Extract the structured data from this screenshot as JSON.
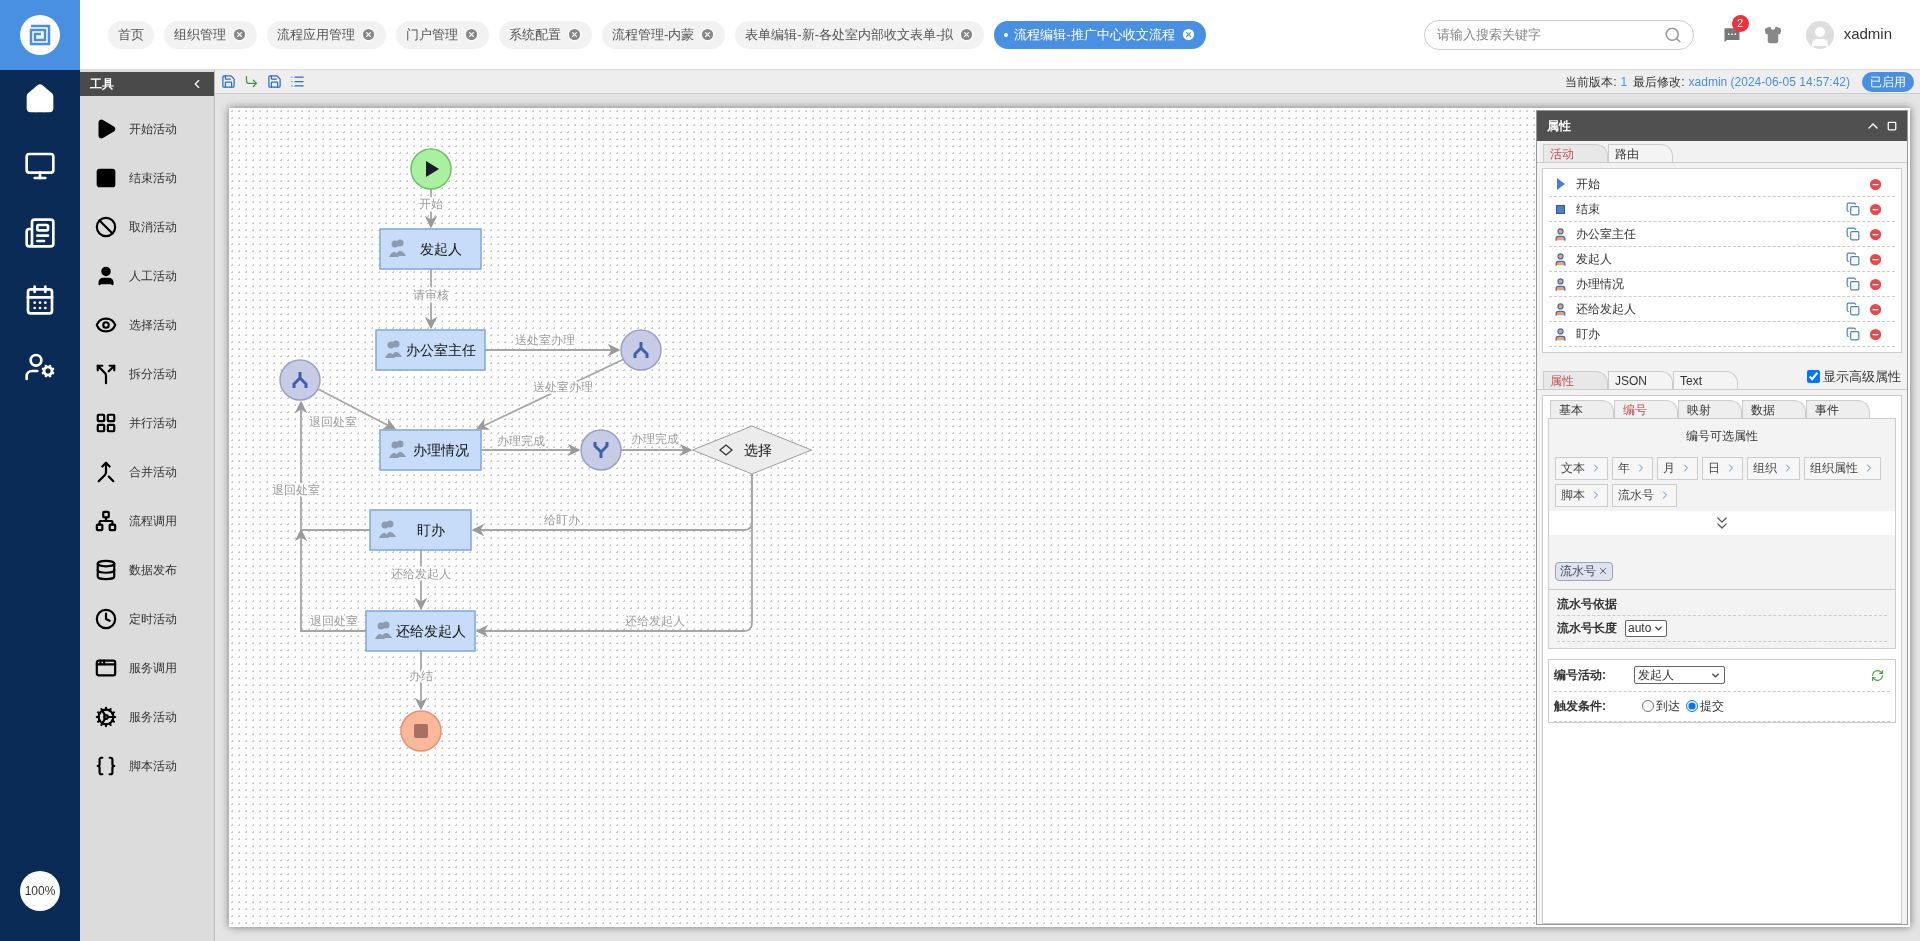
{
  "top_tabs": [
    {
      "label": "首页",
      "closable": false,
      "selected": false
    },
    {
      "label": "组织管理",
      "closable": true,
      "selected": false
    },
    {
      "label": "流程应用管理",
      "closable": true,
      "selected": false
    },
    {
      "label": "门户管理",
      "closable": true,
      "selected": false
    },
    {
      "label": "系统配置",
      "closable": true,
      "selected": false
    },
    {
      "label": "流程管理-内蒙",
      "closable": true,
      "selected": false
    },
    {
      "label": "表单编辑-新-各处室内部收文表单-拟",
      "closable": true,
      "selected": false
    },
    {
      "label": "流程编辑-推广中心收文流程",
      "closable": true,
      "selected": true
    }
  ],
  "search": {
    "placeholder": "请输入搜索关键字"
  },
  "notifications": {
    "badge": "2"
  },
  "user": {
    "name": "xadmin"
  },
  "zoom": "100%",
  "toolbox": {
    "title": "工具",
    "items": [
      {
        "label": "开始活动",
        "kind": "start"
      },
      {
        "label": "结束活动",
        "kind": "end"
      },
      {
        "label": "取消活动",
        "kind": "cancel"
      },
      {
        "label": "人工活动",
        "kind": "manual"
      },
      {
        "label": "选择活动",
        "kind": "choice"
      },
      {
        "label": "拆分活动",
        "kind": "split"
      },
      {
        "label": "并行活动",
        "kind": "parallel"
      },
      {
        "label": "合并活动",
        "kind": "merge"
      },
      {
        "label": "流程调用",
        "kind": "subprocess"
      },
      {
        "label": "数据发布",
        "kind": "publish"
      },
      {
        "label": "定时活动",
        "kind": "timer"
      },
      {
        "label": "服务调用",
        "kind": "invoke"
      },
      {
        "label": "服务活动",
        "kind": "service"
      },
      {
        "label": "脚本活动",
        "kind": "script"
      }
    ]
  },
  "version_bar": {
    "version_label": "当前版本:",
    "version": "1",
    "modified_label": "最后修改:",
    "modified": "xadmin (2024-06-05 14:57:42)",
    "status": "已启用"
  },
  "diagram": {
    "nodes": [
      {
        "kind": "start"
      },
      {
        "kind": "task",
        "label": "发起人"
      },
      {
        "kind": "task",
        "label": "办公室主任"
      },
      {
        "kind": "split"
      },
      {
        "kind": "split"
      },
      {
        "kind": "task",
        "label": "办理情况"
      },
      {
        "kind": "merge"
      },
      {
        "kind": "choice",
        "label": "选择"
      },
      {
        "kind": "task",
        "label": "盯办"
      },
      {
        "kind": "task",
        "label": "还给发起人"
      },
      {
        "kind": "end"
      }
    ],
    "edges": [
      {
        "label": "开始"
      },
      {
        "label": "请审核"
      },
      {
        "label": "送处室办理"
      },
      {
        "label": "送处室办理"
      },
      {
        "label": "退回处室"
      },
      {
        "label": "办理完成"
      },
      {
        "label": "办理完成"
      },
      {
        "label": "给盯办"
      },
      {
        "label": "还给发起人"
      },
      {
        "label": "退回处室"
      },
      {
        "label": "退回处室"
      },
      {
        "label": "还给发起人"
      },
      {
        "label": "办结"
      }
    ]
  },
  "properties": {
    "title": "属性",
    "list_tabs": [
      {
        "label": "活动",
        "selected": true
      },
      {
        "label": "路由",
        "selected": false
      }
    ],
    "activities": [
      {
        "label": "开始",
        "kind": "start",
        "copyable": false
      },
      {
        "label": "结束",
        "kind": "end",
        "copyable": true
      },
      {
        "label": "办公室主任",
        "kind": "user",
        "copyable": true
      },
      {
        "label": "发起人",
        "kind": "user",
        "copyable": true
      },
      {
        "label": "办理情况",
        "kind": "user",
        "copyable": true
      },
      {
        "label": "还给发起人",
        "kind": "user",
        "copyable": true
      },
      {
        "label": "盯办",
        "kind": "user",
        "copyable": true
      }
    ],
    "view_tabs": [
      {
        "label": "属性",
        "selected": true
      },
      {
        "label": "JSON",
        "selected": false
      },
      {
        "label": "Text",
        "selected": false
      }
    ],
    "advanced": {
      "label": "显示高级属性",
      "checked": true
    },
    "sub_tabs": [
      {
        "label": "基本",
        "selected": false
      },
      {
        "label": "编号",
        "selected": true
      },
      {
        "label": "映射",
        "selected": false
      },
      {
        "label": "数据",
        "selected": false
      },
      {
        "label": "事件",
        "selected": false
      }
    ],
    "section_title": "编号可选属性",
    "options": [
      "文本",
      "年",
      "月",
      "日",
      "组织",
      "组织属性",
      "脚本",
      "流水号"
    ],
    "chosen": [
      "流水号"
    ],
    "serial_basis": "流水号依据",
    "serial_length": {
      "label": "流水号长度",
      "value": "auto"
    },
    "number_activity": {
      "label": "编号活动:",
      "value": "发起人"
    },
    "trigger": {
      "label": "触发条件:",
      "options": [
        {
          "label": "到达",
          "selected": false
        },
        {
          "label": "提交",
          "selected": true
        }
      ]
    }
  }
}
